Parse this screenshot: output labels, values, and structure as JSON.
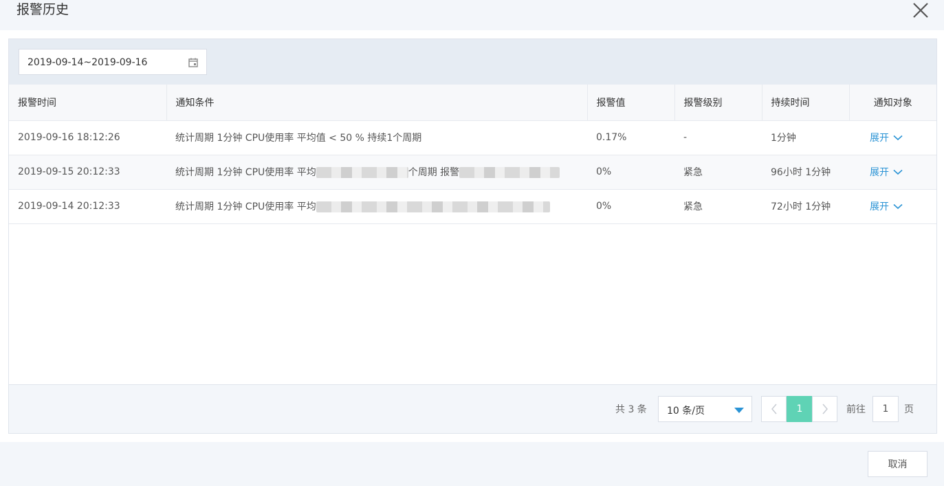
{
  "dialog": {
    "title": "报警历史"
  },
  "filter": {
    "date_range": "2019-09-14~2019-09-16"
  },
  "table": {
    "columns": [
      "报警时间",
      "通知条件",
      "报警值",
      "报警级别",
      "持续时间",
      "通知对象"
    ],
    "rows": [
      {
        "time": "2019-09-16 18:12:26",
        "condition": "统计周期 1分钟 CPU使用率 平均值 < 50 % 持续1个周期",
        "value": "0.17%",
        "level": "-",
        "duration": "1分钟",
        "target": "展开"
      },
      {
        "time": "2019-09-15 20:12:33",
        "condition_start": "统计周期 1分钟 CPU使用率 平均",
        "condition_mid": "个周期 报警",
        "value": "0%",
        "level": "紧急",
        "duration": "96小时 1分钟",
        "target": "展开"
      },
      {
        "time": "2019-09-14 20:12:33",
        "condition_start": "统计周期 1分钟 CPU使用率 平均",
        "value": "0%",
        "level": "紧急",
        "duration": "72小时 1分钟",
        "target": "展开"
      }
    ]
  },
  "pagination": {
    "total": "共 3 条",
    "page_size": "10 条/页",
    "current_page": "1",
    "goto_label": "前往",
    "goto_value": "1",
    "page_unit": "页"
  },
  "actions": {
    "cancel": "取消"
  },
  "colors": {
    "accent": "#2a93d5",
    "active_page": "#5fd3b5"
  }
}
